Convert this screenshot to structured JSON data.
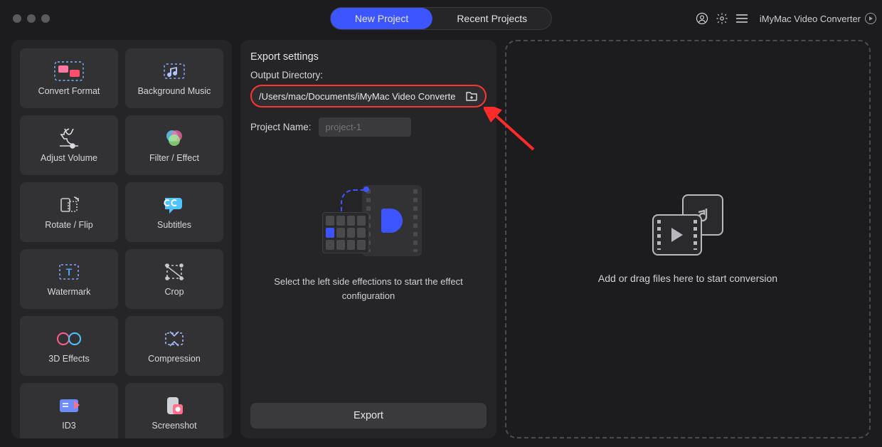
{
  "app_name": "iMyMac Video Converter",
  "tabs": {
    "new": "New Project",
    "recent": "Recent Projects"
  },
  "tools": [
    {
      "id": "convert-format",
      "label": "Convert Format"
    },
    {
      "id": "background-music",
      "label": "Background Music"
    },
    {
      "id": "adjust-volume",
      "label": "Adjust Volume"
    },
    {
      "id": "filter-effect",
      "label": "Filter / Effect"
    },
    {
      "id": "rotate-flip",
      "label": "Rotate / Flip"
    },
    {
      "id": "subtitles",
      "label": "Subtitles"
    },
    {
      "id": "watermark",
      "label": "Watermark"
    },
    {
      "id": "crop",
      "label": "Crop"
    },
    {
      "id": "3d-effects",
      "label": "3D Effects"
    },
    {
      "id": "compression",
      "label": "Compression"
    },
    {
      "id": "id3",
      "label": "ID3"
    },
    {
      "id": "screenshot",
      "label": "Screenshot"
    }
  ],
  "center": {
    "title": "Export settings",
    "output_dir_label": "Output Directory:",
    "output_dir_value": "/Users/mac/Documents/iMyMac Video Converte",
    "project_name_label": "Project Name:",
    "project_name_placeholder": "project-1",
    "hint": "Select the left side effections to start the effect configuration",
    "export_btn": "Export"
  },
  "drop": {
    "text": "Add or drag files here to start conversion"
  },
  "header_icons": {
    "account": "account-icon",
    "settings": "gear-icon",
    "menu": "menu-icon"
  }
}
